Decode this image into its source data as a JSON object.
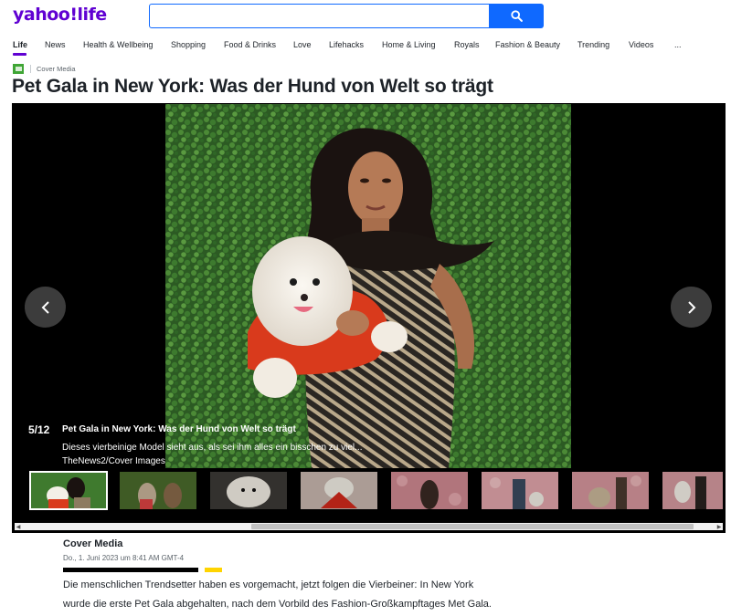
{
  "brand": {
    "logo_text": "yahoo!life",
    "accent": "#6001d2",
    "search_accent": "#0f69ff"
  },
  "search": {
    "value": "",
    "placeholder": "",
    "button_icon": "search-icon"
  },
  "nav": {
    "items": [
      {
        "label": "Life",
        "active": true
      },
      {
        "label": "News"
      },
      {
        "label": "Health & Wellbeing"
      },
      {
        "label": "Shopping"
      },
      {
        "label": "Food & Drinks"
      },
      {
        "label": "Love"
      },
      {
        "label": "Lifehacks"
      },
      {
        "label": "Home & Living"
      },
      {
        "label": "Royals"
      },
      {
        "label": "Fashion & Beauty"
      },
      {
        "label": "Trending"
      },
      {
        "label": "Videos"
      },
      {
        "label": "..."
      }
    ]
  },
  "source": {
    "name": "Cover Media",
    "logo_color": "#3fa535"
  },
  "article": {
    "headline": "Pet Gala in New York: Was der Hund von Welt so trägt",
    "author": "Cover Media",
    "date": "Do., 1. Juni 2023 um 8:41 AM GMT-4",
    "body": [
      "Die menschlichen Trendsetter haben es vorgemacht, jetzt folgen die Vierbeiner: In New York",
      "wurde die erste Pet Gala abgehalten, nach dem Vorbild des Fashion-Großkampftages Met  Gala."
    ]
  },
  "slideshow": {
    "counter": "5/12",
    "title": "Pet Gala in New York: Was der Hund von Welt so trägt",
    "caption": "Dieses vierbeinige Model sieht aus, als sei ihm alles ein bisschen zu viel...",
    "credit": "TheNews2/Cover Images",
    "prev_icon": "chevron-left-icon",
    "next_icon": "chevron-right-icon",
    "thumbnails": [
      {
        "alt": "Model mit Spitz",
        "active": true
      },
      {
        "alt": "Hunde im Kostüm"
      },
      {
        "alt": "Weißer Hund"
      },
      {
        "alt": "Rote Federn"
      },
      {
        "alt": "Rosenwand"
      },
      {
        "alt": "Person an Rosenwand"
      },
      {
        "alt": "Hund an Rosenwand"
      },
      {
        "alt": "Person mit Hund"
      }
    ]
  }
}
